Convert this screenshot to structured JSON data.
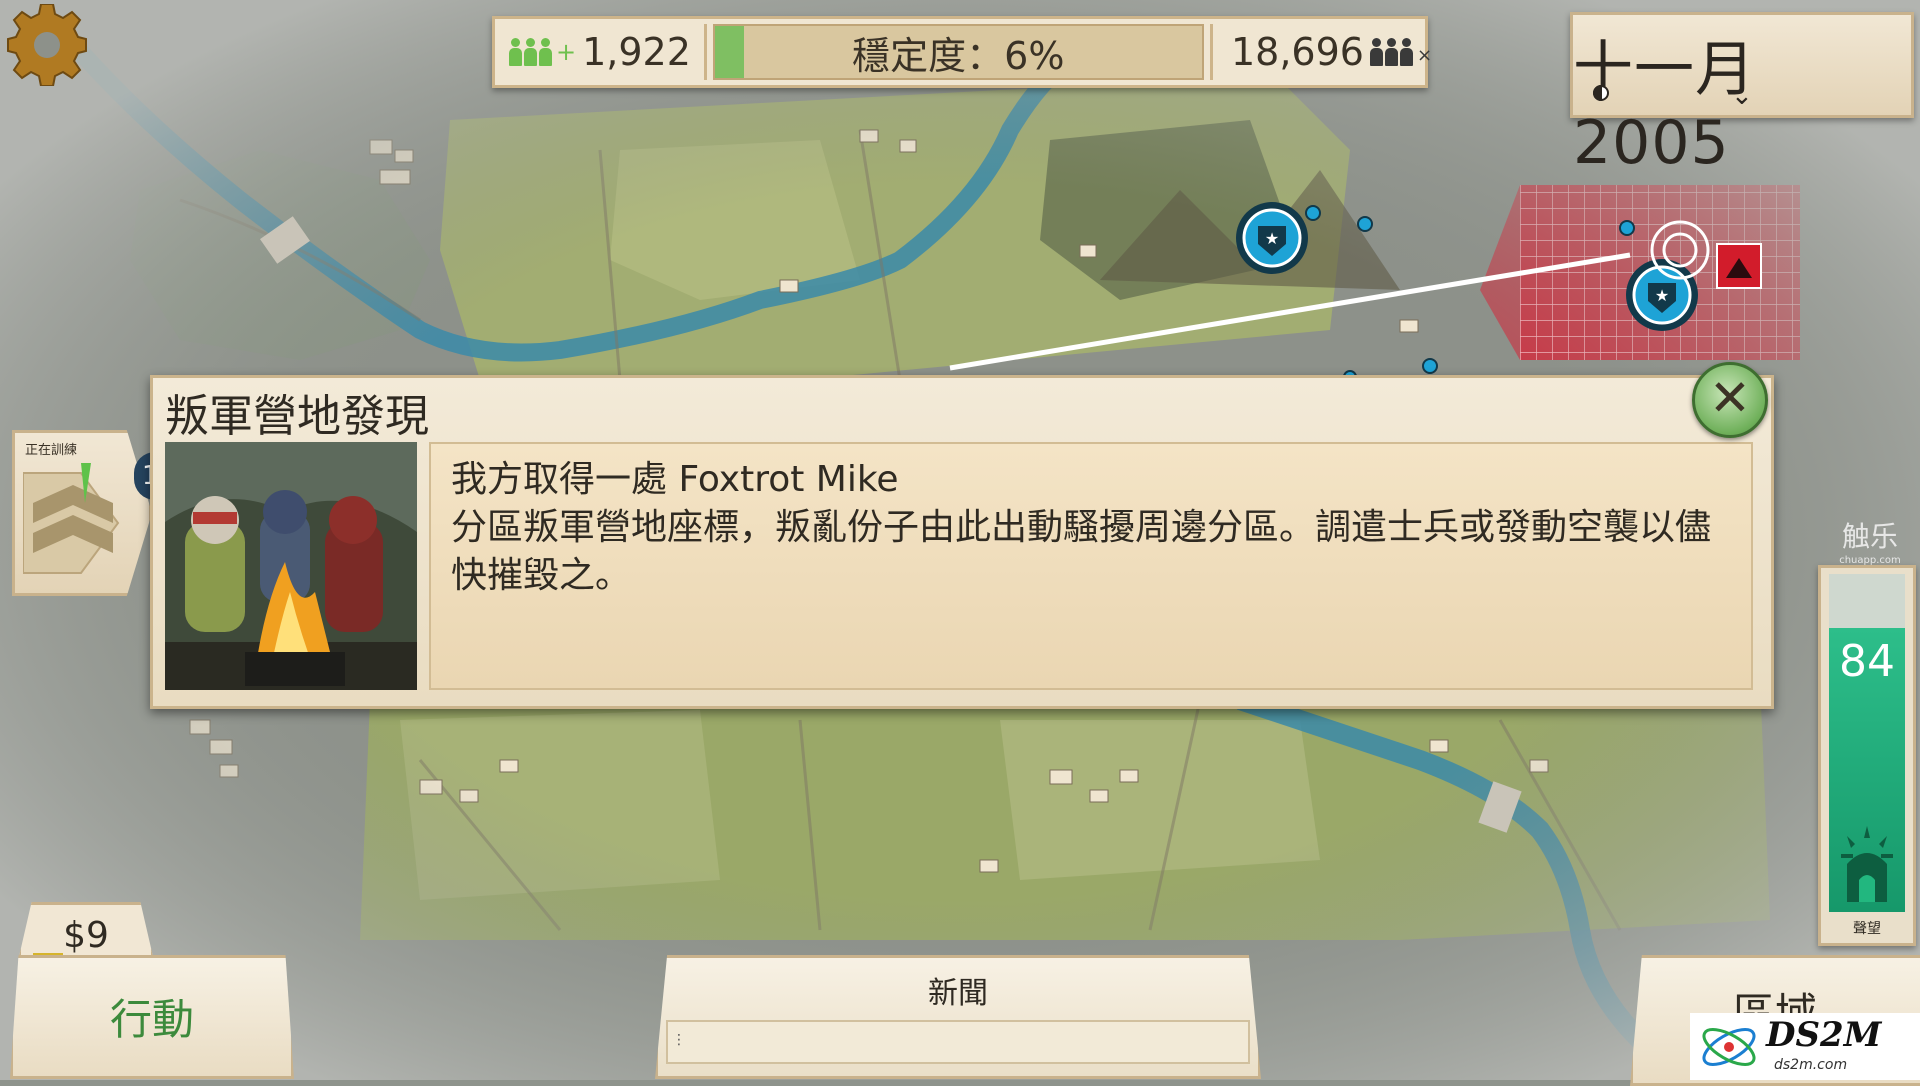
{
  "top_bar": {
    "supporters": "1,922",
    "stability_label": "穩定度：6%",
    "stability_fraction": 0.06,
    "opponents": "18,696"
  },
  "date": {
    "label": "十一月 2005"
  },
  "training": {
    "label": "正在訓練",
    "count": "1"
  },
  "event": {
    "title": "叛軍營地發現",
    "body_line1": "我方取得一處 Foxtrot Mike",
    "body_line2": "分區叛軍營地座標，叛亂份子由此出動騷擾周邊分區。調遣士兵或發動空襲以儘快摧毀之。"
  },
  "reputation": {
    "value": "84",
    "fraction": 0.84,
    "label": "聲望"
  },
  "bottom": {
    "money": "$9",
    "action_label": "行動",
    "news_label": "新聞",
    "region_label": "區域"
  },
  "watermarks": {
    "chuapp": "触乐",
    "chuapp_sub": "chuapp.com",
    "ds2m": "DS2M",
    "ds2m_sub": "ds2m.com"
  },
  "colors": {
    "map_base": "#8e938c",
    "field_green": "#9aa868",
    "river": "#3b8aa8",
    "rebel_zone": "#d22a3c",
    "unit_blue": "#1ea3d6",
    "reputation_green": "#1faa7a",
    "stability_green": "#7fbf62"
  },
  "icons": [
    "gear-icon",
    "supporters-icon",
    "opponents-icon",
    "moon-icon",
    "chevron-down-icon",
    "close-icon",
    "rank-chevron-icon",
    "reputation-icon",
    "police-unit-icon",
    "rebel-camp-icon",
    "target-icon"
  ]
}
